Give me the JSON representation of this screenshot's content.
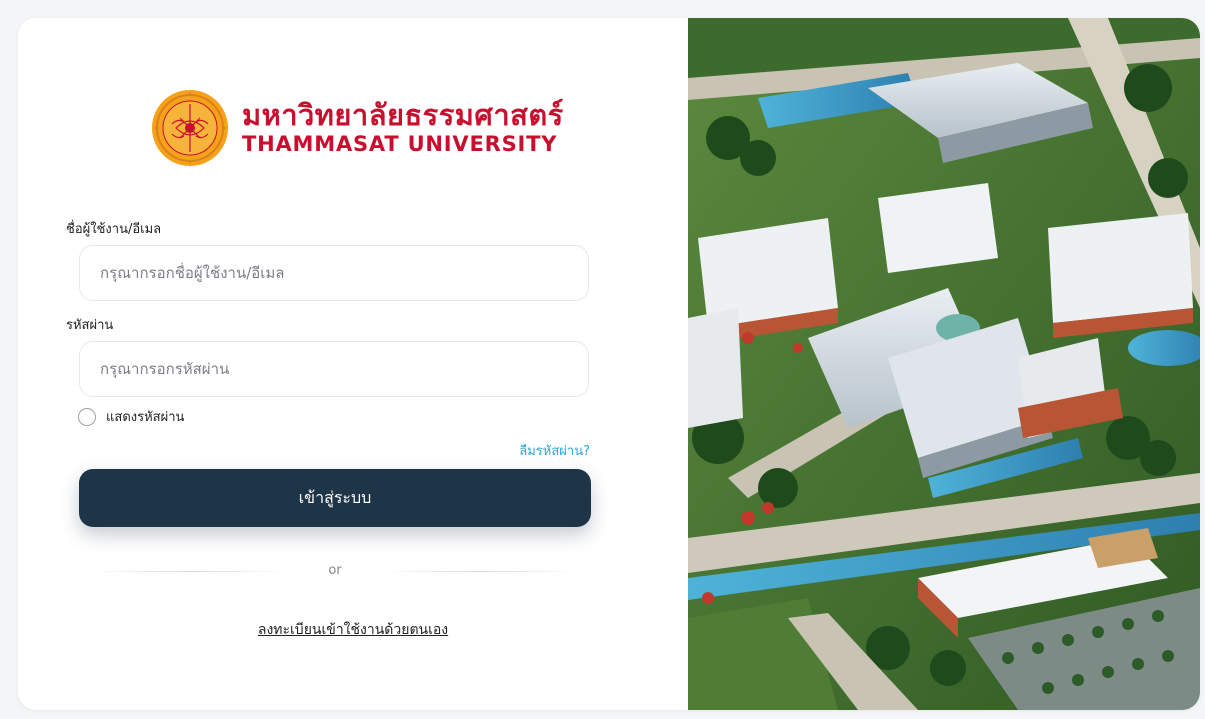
{
  "brand": {
    "name_th": "มหาวิทยาลัยธรรมศาสตร์",
    "name_en": "THAMMASAT UNIVERSITY",
    "brand_red": "#c8102e",
    "seal_color": "#f5a21a"
  },
  "login": {
    "username_label": "ชื่อผู้ใช้งาน/อีเมล",
    "username_placeholder": "กรุณากรอกชื่อผู้ใช้งาน/อีเมล",
    "password_label": "รหัสผ่าน",
    "password_placeholder": "กรุณากรอกรหัสผ่าน",
    "show_password_label": "แสดงรหัสผ่าน",
    "forgot_password_label": "ลืมรหัสผ่าน?",
    "submit_label": "เข้าสู่ระบบ",
    "divider_label": "or",
    "register_label": "ลงทะเบียนเข้าใช้งานด้วยตนเอง"
  },
  "colors": {
    "button_bg": "#1e3547",
    "link_blue": "#2aa8d8"
  },
  "hero_image": {
    "icon": "campus-aerial-illustration"
  }
}
